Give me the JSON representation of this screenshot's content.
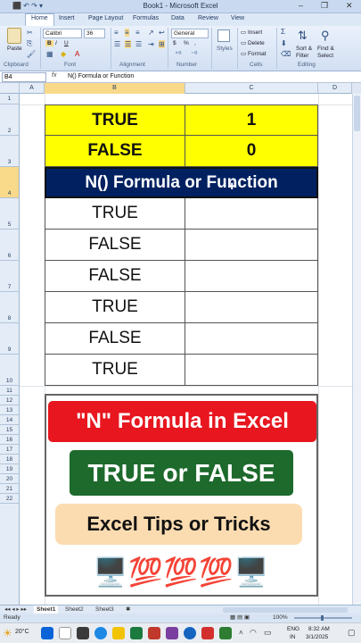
{
  "window": {
    "title": "Book1 - Microsoft Excel",
    "minimize": "–",
    "restore": "❐",
    "close": "✕",
    "quick_access": "⬛ ↶ ↷ ▾"
  },
  "ribbon": {
    "tabs": [
      "Home",
      "Insert",
      "Page Layout",
      "Formulas",
      "Data",
      "Review",
      "View"
    ],
    "clipboard": {
      "paste": "Paste",
      "label": "Clipboard"
    },
    "font": {
      "name": "Calibri",
      "size": "36",
      "bold": "B",
      "italic": "I",
      "underline": "U",
      "label": "Font"
    },
    "alignment": {
      "label": "Alignment"
    },
    "number": {
      "format": "General",
      "currency": "$",
      "percent": "%",
      "comma": ",",
      "label": "Number"
    },
    "styles": {
      "label": "Styles"
    },
    "cells": {
      "insert": "Insert",
      "delete": "Delete",
      "format": "Format",
      "label": "Cells"
    },
    "editing": {
      "sum": "Σ",
      "sort": "Sort &",
      "filter": "Filter",
      "find": "Find &",
      "select": "Select",
      "label": "Editing"
    }
  },
  "formula_bar": {
    "name_box": "B4",
    "fx": "fx",
    "formula": "N() Formula or Function"
  },
  "columns": [
    "A",
    "B",
    "C",
    "D"
  ],
  "rows": [
    "1",
    "2",
    "3",
    "4",
    "5",
    "6",
    "7",
    "8",
    "9",
    "10",
    "11",
    "12",
    "13",
    "14",
    "15",
    "16",
    "17",
    "18",
    "19",
    "20",
    "21",
    "22"
  ],
  "table": {
    "header_rows": [
      {
        "b": "TRUE",
        "c": "1"
      },
      {
        "b": "FALSE",
        "c": "0"
      }
    ],
    "title": "N() Formula or Function",
    "values": [
      "TRUE",
      "FALSE",
      "FALSE",
      "TRUE",
      "FALSE",
      "TRUE"
    ]
  },
  "banner": {
    "line1": "\"N\" Formula in Excel",
    "line2": "TRUE or FALSE",
    "line3": "Excel Tips or Tricks",
    "emoji_row": "🖥️💯💯💯🖥️"
  },
  "sheets": [
    "Sheet1",
    "Sheet2",
    "Sheet3"
  ],
  "status": {
    "ready": "Ready",
    "zoom": "100%"
  },
  "taskbar": {
    "weather": "20°C",
    "lang1": "ENG",
    "lang2": "IN",
    "time": "8:32 AM",
    "date": "3/1/2025"
  },
  "colors": {
    "yellow": "#ffff00",
    "navy": "#002060",
    "banner_red": "#e8161f",
    "banner_green": "#1d6a2c",
    "banner_peach": "#fbdcb0"
  }
}
